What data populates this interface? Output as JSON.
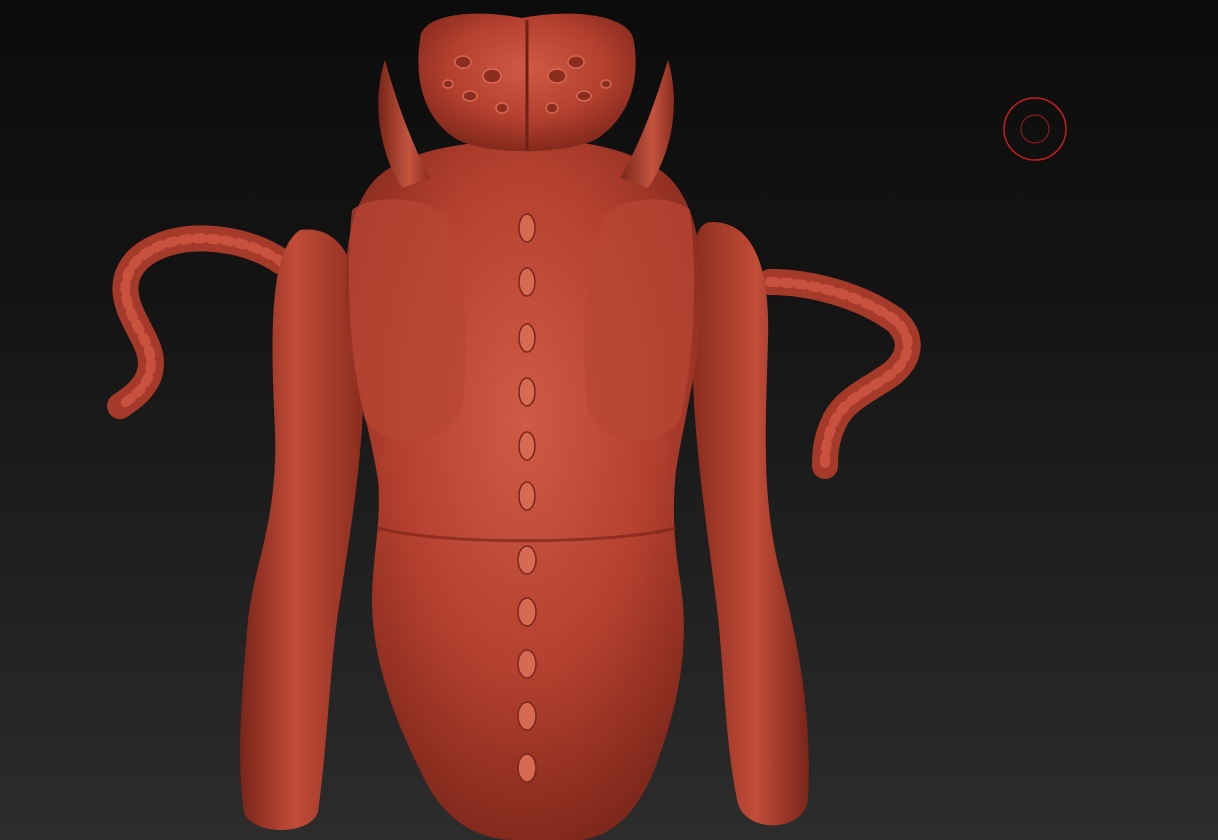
{
  "canvas": {
    "background_top": "#0c0c0c",
    "background_bottom": "#2c2c2c"
  },
  "model": {
    "material_color": "#b5402f",
    "highlight_color": "#d9654f",
    "shadow_color": "#6e2017",
    "icon": "sculpted-creature-model"
  },
  "brush": {
    "icon": "brush-cursor-icon",
    "color": "#c81e1e"
  }
}
